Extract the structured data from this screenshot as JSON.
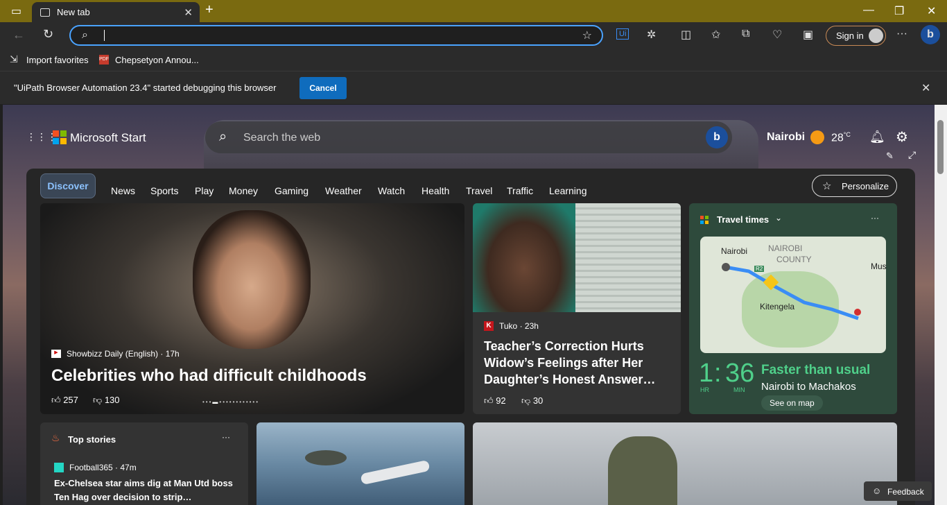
{
  "browser": {
    "tab_title": "New tab",
    "signin_label": "Sign in",
    "favorites": [
      "Import favorites",
      "Chepsetyon Annou..."
    ],
    "infobar_text": "\"UiPath Browser Automation 23.4\" started debugging this browser",
    "cancel_label": "Cancel"
  },
  "header": {
    "brand": "Microsoft Start",
    "search_placeholder": "Search the web",
    "location": "Nairobi",
    "temperature": "28",
    "temp_unit": "°C"
  },
  "nav": {
    "items": [
      "Discover",
      "News",
      "Sports",
      "Play",
      "Money",
      "Gaming",
      "Weather",
      "Watch",
      "Health",
      "Travel",
      "Traffic",
      "Learning"
    ],
    "personalize": "Personalize"
  },
  "hero": {
    "source": "Showbizz Daily (English) · 17h",
    "title": "Celebrities who had difficult childhoods",
    "likes": "257",
    "dislikes": "130"
  },
  "article2": {
    "source": "Tuko · 23h",
    "title": "Teacher’s Correction Hurts Widow’s Feelings after Her Daughter’s Honest Answer…",
    "likes": "92",
    "dislikes": "30"
  },
  "travel": {
    "label": "Travel times",
    "time_hr": "1",
    "time_min": "36",
    "hr_label": "HR",
    "min_label": "MIN",
    "status": "Faster than usual",
    "route": "Nairobi to Machakos",
    "see_map": "See on map",
    "map_labels": [
      "Nairobi",
      "NAIROBI",
      "COUNTY",
      "Kitengela",
      "Mus",
      "R2"
    ]
  },
  "top_stories": {
    "label": "Top stories",
    "source": "Football365 · 47m",
    "title": "Ex-Chelsea star aims dig at Man Utd boss Ten Hag over decision to strip…"
  },
  "feedback": "Feedback",
  "colors": {
    "accent": "#0f6cbd",
    "titlebar": "#7a6a10",
    "travel_green": "#4fd08a"
  }
}
